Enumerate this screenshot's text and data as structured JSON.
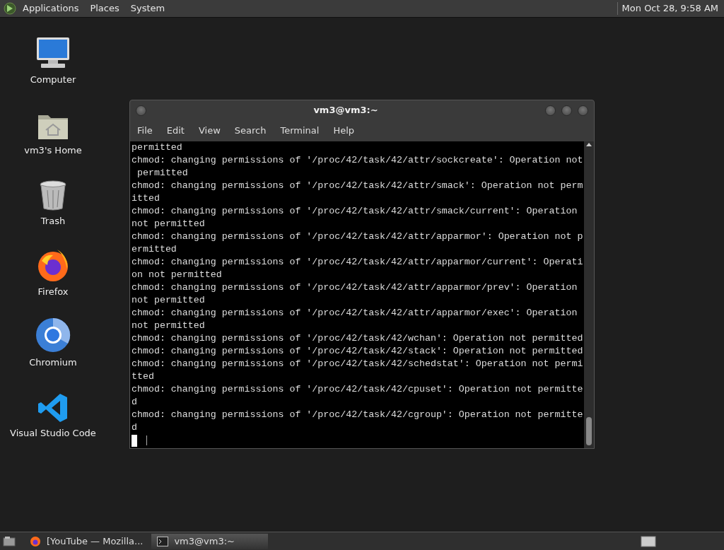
{
  "top_panel": {
    "menus": [
      "Applications",
      "Places",
      "System"
    ],
    "clock": "Mon Oct 28,  9:58 AM"
  },
  "desktop_icons": [
    {
      "kind": "computer",
      "label": "Computer"
    },
    {
      "kind": "home",
      "label": "vm3's Home"
    },
    {
      "kind": "trash",
      "label": "Trash"
    },
    {
      "kind": "firefox",
      "label": "Firefox"
    },
    {
      "kind": "chromium",
      "label": "Chromium"
    },
    {
      "kind": "vscode",
      "label": "Visual Studio Code"
    }
  ],
  "terminal": {
    "title": "vm3@vm3:~",
    "menus": [
      "File",
      "Edit",
      "View",
      "Search",
      "Terminal",
      "Help"
    ],
    "lines": [
      "permitted",
      "chmod: changing permissions of '/proc/42/task/42/attr/sockcreate': Operation not",
      " permitted",
      "chmod: changing permissions of '/proc/42/task/42/attr/smack': Operation not perm",
      "itted",
      "chmod: changing permissions of '/proc/42/task/42/attr/smack/current': Operation",
      "not permitted",
      "chmod: changing permissions of '/proc/42/task/42/attr/apparmor': Operation not p",
      "ermitted",
      "chmod: changing permissions of '/proc/42/task/42/attr/apparmor/current': Operati",
      "on not permitted",
      "chmod: changing permissions of '/proc/42/task/42/attr/apparmor/prev': Operation",
      "not permitted",
      "chmod: changing permissions of '/proc/42/task/42/attr/apparmor/exec': Operation",
      "not permitted",
      "chmod: changing permissions of '/proc/42/task/42/wchan': Operation not permitted",
      "chmod: changing permissions of '/proc/42/task/42/stack': Operation not permitted",
      "chmod: changing permissions of '/proc/42/task/42/schedstat': Operation not permi",
      "tted",
      "chmod: changing permissions of '/proc/42/task/42/cpuset': Operation not permitte",
      "d",
      "chmod: changing permissions of '/proc/42/task/42/cgroup': Operation not permitte",
      "d"
    ]
  },
  "taskbar": {
    "items": [
      {
        "kind": "firefox",
        "label": "[YouTube — Mozilla...",
        "selected": false
      },
      {
        "kind": "terminal",
        "label": "vm3@vm3:~",
        "selected": true
      }
    ]
  }
}
